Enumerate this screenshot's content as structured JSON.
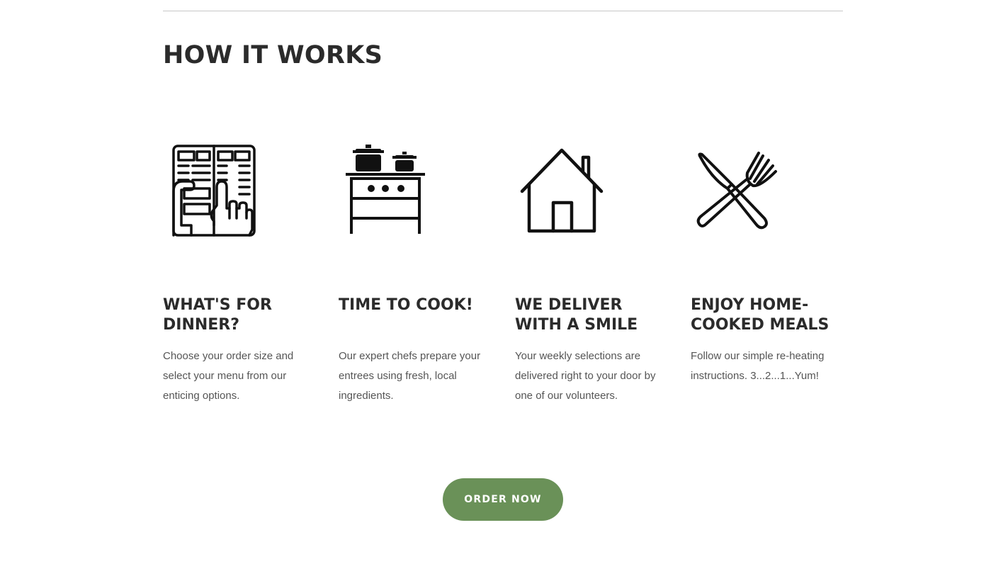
{
  "section": {
    "title": "HOW IT WORKS"
  },
  "steps": [
    {
      "icon": "menu-selection-icon",
      "title": "WHAT'S FOR DINNER?",
      "description": "Choose your order size and select your menu from our enticing options."
    },
    {
      "icon": "stove-icon",
      "title": "TIME TO COOK!",
      "description": "Our expert chefs prepare your entrees using fresh, local ingredients."
    },
    {
      "icon": "house-icon",
      "title": "WE DELIVER WITH A SMILE",
      "description": "Your weekly selections are delivered right to your door by one of our volunteers."
    },
    {
      "icon": "knife-fork-icon",
      "title": "ENJOY HOME-COOKED MEALS",
      "description": "Follow our simple re-heating instructions. 3...2...1...Yum!"
    }
  ],
  "cta": {
    "label": "ORDER NOW"
  },
  "colors": {
    "heading": "#2b2b2b",
    "body_text": "#555555",
    "button": "#6a9158",
    "button_text": "#ffffff",
    "divider": "#c8c8c8"
  }
}
